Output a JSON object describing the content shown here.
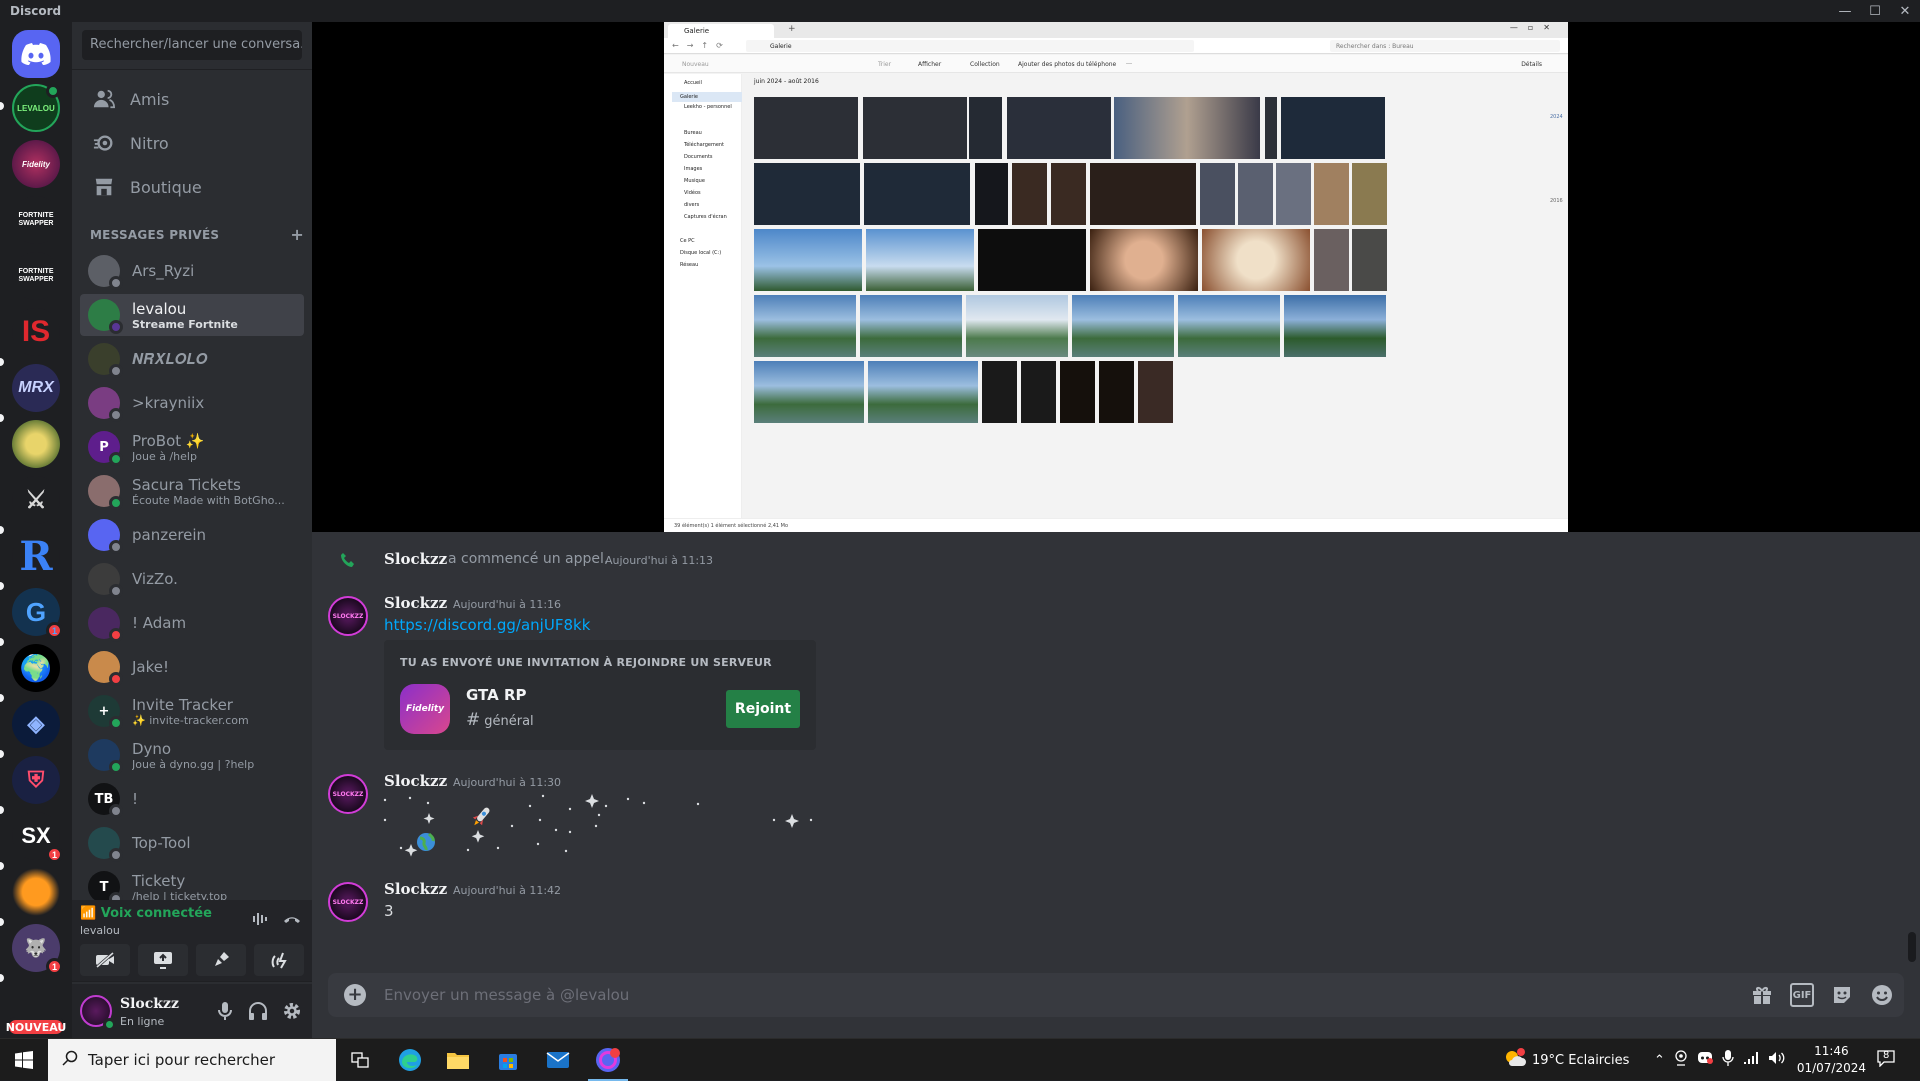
{
  "window": {
    "title": "Discord"
  },
  "servers": [
    {
      "label": "",
      "badge": ""
    },
    {
      "label": "LEVALOU",
      "badge": ""
    },
    {
      "label": "Fidelity",
      "badge": ""
    },
    {
      "label": "FORTNITE SWAPPER",
      "badge": ""
    },
    {
      "label": "FORTNITE SWAPPER",
      "badge": ""
    },
    {
      "label": "IS",
      "badge": ""
    },
    {
      "label": "MRX",
      "badge": ""
    },
    {
      "label": "",
      "badge": ""
    },
    {
      "label": "",
      "badge": ""
    },
    {
      "label": "R",
      "badge": ""
    },
    {
      "label": "",
      "badge": "1"
    },
    {
      "label": "",
      "badge": ""
    },
    {
      "label": "",
      "badge": ""
    },
    {
      "label": "",
      "badge": ""
    },
    {
      "label": "SX",
      "badge": "1"
    },
    {
      "label": "",
      "badge": ""
    },
    {
      "label": "",
      "badge": "1"
    }
  ],
  "new_badge": "NOUVEAU",
  "search": {
    "placeholder": "Rechercher/lancer une conversa..."
  },
  "nav": [
    {
      "label": "Amis",
      "icon": "friends-icon"
    },
    {
      "label": "Nitro",
      "icon": "nitro-icon"
    },
    {
      "label": "Boutique",
      "icon": "shop-icon"
    }
  ],
  "dm_header": {
    "label": "MESSAGES PRIVÉS",
    "add": "+"
  },
  "dms": [
    {
      "name": "Ars_Ryzi",
      "sub": "",
      "initials": "",
      "color": "#5c5f66",
      "status": "#80848e"
    },
    {
      "name": "levalou",
      "sub": "Streame Fortnite",
      "initials": "",
      "color": "#2d7d46",
      "status": "#593695"
    },
    {
      "name": "𝑵𝑹𝑿𝑳𝑶𝑳𝑶",
      "sub": "",
      "initials": "",
      "color": "#3a3f2c",
      "status": "#80848e"
    },
    {
      "name": ">krayniix",
      "sub": "",
      "initials": "",
      "color": "#7a3d82",
      "status": "#80848e"
    },
    {
      "name": "ProBot ✨",
      "sub": "Joue à /help",
      "initials": "P",
      "color": "#5e1e8c",
      "status": "#23a55a"
    },
    {
      "name": "Sacura Tickets",
      "sub": "Écoute  Made with BotGho...",
      "initials": "",
      "color": "#8a6d6d",
      "status": "#23a55a"
    },
    {
      "name": "panzerein",
      "sub": "",
      "initials": "",
      "color": "#5865f2",
      "status": "#80848e"
    },
    {
      "name": "VizZo.",
      "sub": "",
      "initials": "",
      "color": "#3c3c3c",
      "status": "#80848e"
    },
    {
      "name": "! Adam",
      "sub": "",
      "initials": "",
      "color": "#4a2860",
      "status": "#f23f43"
    },
    {
      "name": "Jake!",
      "sub": "",
      "initials": "",
      "color": "#c98a4b",
      "status": "#f23f43"
    },
    {
      "name": "Invite Tracker",
      "sub": "✨ invite-tracker.com",
      "initials": "+",
      "color": "#1e3a36",
      "status": "#23a55a"
    },
    {
      "name": "Dyno",
      "sub": "Joue à dyno.gg | ?help",
      "initials": "",
      "color": "#1e3a5f",
      "status": "#23a55a"
    },
    {
      "name": "!",
      "sub": "",
      "initials": "TB",
      "color": "#111214",
      "status": "#80848e"
    },
    {
      "name": "Top-Tool",
      "sub": "",
      "initials": "",
      "color": "#244a4d",
      "status": "#80848e"
    },
    {
      "name": "Tickety",
      "sub": "/help | tickety.top",
      "initials": "T",
      "color": "#111214",
      "status": "#80848e"
    }
  ],
  "voice": {
    "status": "Voix connectée",
    "channel": "levalou"
  },
  "user": {
    "name": "Slockzz",
    "status": "En ligne"
  },
  "screenshare": {
    "tab": "Galerie",
    "breadcrumb": "Galerie",
    "search_placeholder": "Rechercher dans : Bureau",
    "toolbar": [
      "Nouveau",
      "Trier",
      "Afficher",
      "Collection",
      "Ajouter des photos du téléphone",
      "…",
      "Détails"
    ],
    "date_range": "juin 2024 - août 2016",
    "nav_items": [
      "Accueil",
      "Galerie",
      "Leekho - personnel",
      "Bureau",
      "Téléchargement",
      "Documents",
      "Images",
      "Musique",
      "Vidéos",
      "divers",
      "Captures d'écran",
      "Ce PC",
      "Disque local (C:)",
      "Réseau"
    ],
    "year_labels": [
      "2024",
      "2016"
    ],
    "status": "39 élément(s)    1 élément sélectionné  2,41 Mo"
  },
  "messages": {
    "call": {
      "author": "Slockzz",
      "text": "a commencé un appel.",
      "time": "Aujourd'hui à 11:13"
    },
    "m1": {
      "author": "Slockzz",
      "time": "Aujourd'hui à 11:16",
      "link": "https://discord.gg/anjUF8kk",
      "invite": {
        "title": "TU AS ENVOYÉ UNE INVITATION À REJOINDRE UN SERVEUR",
        "server": "GTA RP",
        "channel": "général",
        "button": "Rejoint"
      }
    },
    "m2": {
      "author": "Slockzz",
      "time": "Aujourd'hui à 11:30"
    },
    "m3": {
      "author": "Slockzz",
      "time": "Aujourd'hui à 11:42",
      "text": "3"
    }
  },
  "composer": {
    "placeholder": "Envoyer un message à @levalou",
    "gif": "GIF"
  },
  "taskbar": {
    "search": "Taper ici pour rechercher",
    "weather": "19°C  Eclaircies",
    "time": "11:46",
    "date": "01/07/2024",
    "notif": "8"
  },
  "colors": {
    "brand": "#5865f2",
    "online": "#23a55a",
    "dnd": "#f23f43",
    "join": "#248046",
    "link": "#00a8fc"
  }
}
